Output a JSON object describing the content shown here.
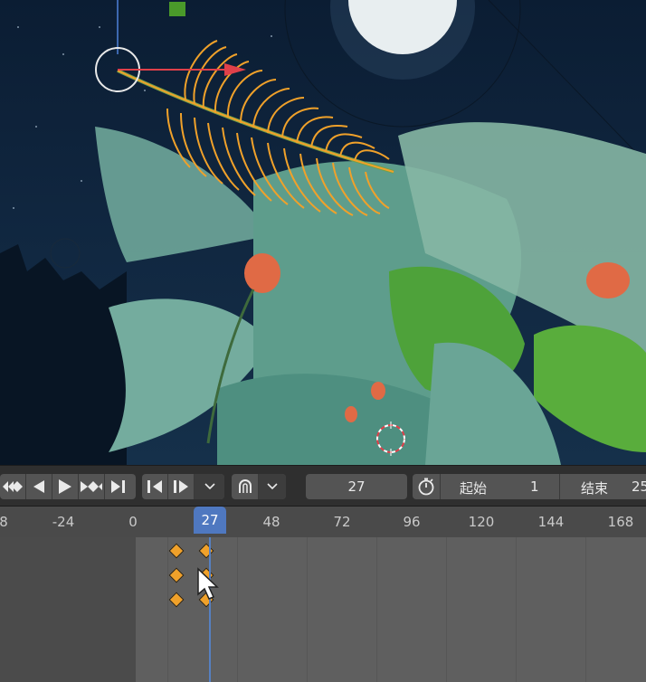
{
  "transport": {
    "buttons": [
      "jump-to-start",
      "step-back",
      "play",
      "jump-to-keyframe",
      "jump-to-end"
    ],
    "keyframe_nav": [
      "prev-keyframe",
      "next-keyframe"
    ],
    "snap_icon": "magnet-icon"
  },
  "frame": {
    "current": "27",
    "playhead_label": "27"
  },
  "range": {
    "start_label": "起始",
    "start_value": "1",
    "end_label": "结束",
    "end_value": "25"
  },
  "ruler": {
    "ticks": [
      "8",
      "-24",
      "0",
      "48",
      "72",
      "96",
      "120",
      "144",
      "168"
    ]
  },
  "colors": {
    "keyframe": "#f0a12a",
    "playhead": "#4f78c0",
    "selection_outline": "#f0a12a",
    "gizmo_x_axis": "#e0404a"
  }
}
